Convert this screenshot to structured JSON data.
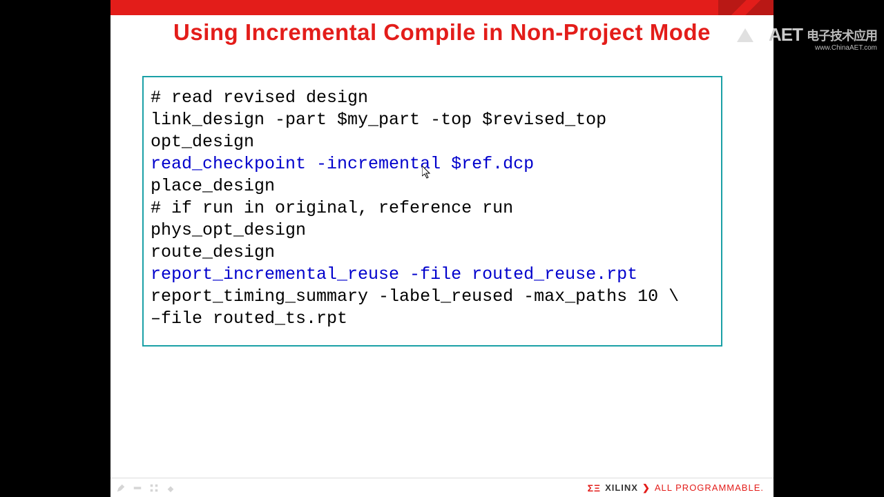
{
  "title": "Using Incremental Compile in Non-Project Mode",
  "code": {
    "lines": [
      {
        "text": "# read revised design",
        "hl": false
      },
      {
        "text": "link_design -part $my_part -top $revised_top",
        "hl": false
      },
      {
        "text": "opt_design",
        "hl": false
      },
      {
        "text": "read_checkpoint -incremental $ref.dcp",
        "hl": true
      },
      {
        "text": "place_design",
        "hl": false
      },
      {
        "text": "# if run in original, reference run",
        "hl": false
      },
      {
        "text": "phys_opt_design",
        "hl": false
      },
      {
        "text": "route_design",
        "hl": false
      },
      {
        "text": "report_incremental_reuse -file routed_reuse.rpt",
        "hl": true
      },
      {
        "text": "report_timing_summary -label_reused -max_paths 10 \\",
        "hl": false
      },
      {
        "text": "–file routed_ts.rpt",
        "hl": false
      }
    ]
  },
  "footer": {
    "brand_mark": "ΣΞ",
    "brand": "XILINX",
    "chevron": "❯",
    "tagline": "ALL PROGRAMMABLE."
  },
  "watermark": {
    "logo_text": "AET",
    "zh": "电子技术应用",
    "url": "www.ChinaAET.com"
  }
}
